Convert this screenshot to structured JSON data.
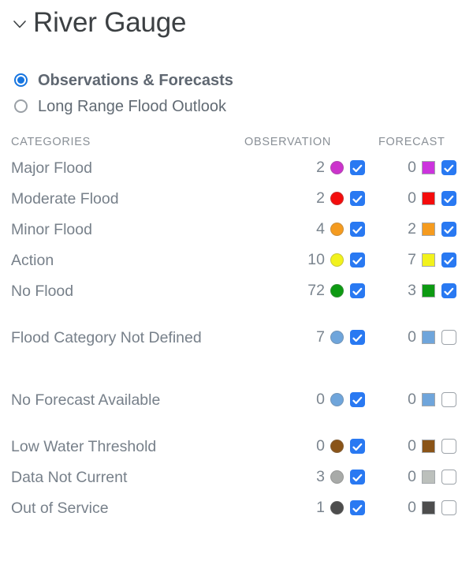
{
  "header": {
    "title": "River Gauge",
    "collapse_icon": "chevron-down-icon"
  },
  "mode_options": [
    {
      "label": "Observations & Forecasts",
      "selected": true
    },
    {
      "label": "Long Range Flood Outlook",
      "selected": false
    }
  ],
  "table": {
    "headers": {
      "categories": "CATEGORIES",
      "observation": "OBSERVATION",
      "forecast": "FORECAST"
    },
    "rows": [
      {
        "category": "Major Flood",
        "obs_count": "2",
        "obs_color": "#cc33cc",
        "obs_checked": true,
        "fc_count": "0",
        "fc_color": "#cc33dd",
        "fc_checked": true
      },
      {
        "category": "Moderate Flood",
        "obs_count": "2",
        "obs_color": "#f40c0c",
        "obs_checked": true,
        "fc_count": "0",
        "fc_color": "#f40c0c",
        "fc_checked": true
      },
      {
        "category": "Minor Flood",
        "obs_count": "4",
        "obs_color": "#f59b1f",
        "obs_checked": true,
        "fc_count": "2",
        "fc_color": "#f59b1f",
        "fc_checked": true
      },
      {
        "category": "Action",
        "obs_count": "10",
        "obs_color": "#f2f21c",
        "obs_checked": true,
        "fc_count": "7",
        "fc_color": "#f2f21c",
        "fc_checked": true
      },
      {
        "category": "No Flood",
        "obs_count": "72",
        "obs_color": "#0d9a12",
        "obs_checked": true,
        "fc_count": "3",
        "fc_color": "#0d9a12",
        "fc_checked": true
      },
      {
        "category": "Flood Category Not Defined",
        "obs_count": "7",
        "obs_color": "#6fa5db",
        "obs_checked": true,
        "fc_count": "0",
        "fc_color": "#6fa5db",
        "fc_checked": false
      },
      {
        "category": "No Forecast Available",
        "obs_count": "0",
        "obs_color": "#6fa5db",
        "obs_checked": true,
        "fc_count": "0",
        "fc_color": "#6fa5db",
        "fc_checked": false
      },
      {
        "category": "Low Water Threshold",
        "obs_count": "0",
        "obs_color": "#8a5418",
        "obs_checked": true,
        "fc_count": "0",
        "fc_color": "#8a5418",
        "fc_checked": false
      },
      {
        "category": "Data Not Current",
        "obs_count": "3",
        "obs_color": "#a8aaa8",
        "obs_checked": true,
        "fc_count": "0",
        "fc_color": "#bcc0bc",
        "fc_checked": false
      },
      {
        "category": "Out of Service",
        "obs_count": "1",
        "obs_color": "#4d4d4d",
        "obs_checked": true,
        "fc_count": "0",
        "fc_color": "#4d4d4d",
        "fc_checked": false
      }
    ]
  },
  "colors": {
    "accent": "#2979f2",
    "radio_selected": "#1675e0",
    "text": "#77808a",
    "header_text": "#8a9097",
    "title": "#3c4043"
  }
}
